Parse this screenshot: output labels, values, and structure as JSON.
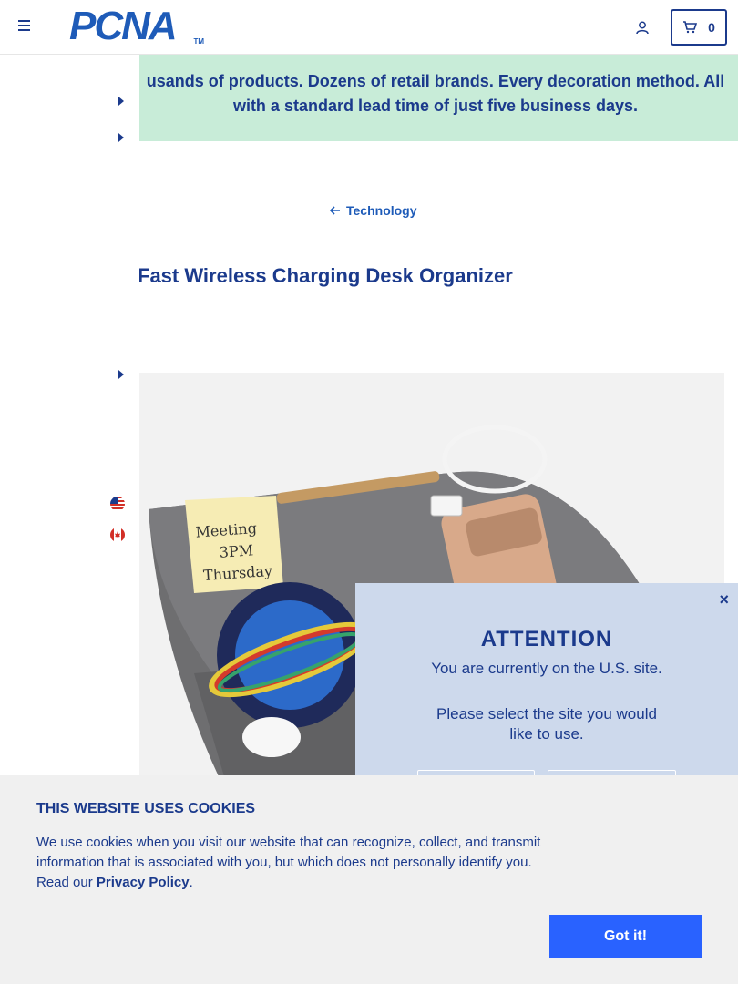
{
  "header": {
    "logo_text": "PCNA",
    "logo_tm": "TM",
    "cart_count": "0"
  },
  "banner": {
    "text": "usands of products. Dozens of retail brands. Every decoration method. All with a standard lead time of just five business days."
  },
  "breadcrumb": {
    "back_label": "Technology"
  },
  "product": {
    "title": "Fast Wireless Charging Desk Organizer",
    "image_note_text": "Meeting 3PM Thursday"
  },
  "locale_modal": {
    "title": "ATTENTION",
    "line1": "You are currently on the U.S. site.",
    "line2": "Please select the site you would like to use.",
    "close_label": "×"
  },
  "cookie_banner": {
    "title": "THIS WEBSITE USES COOKIES",
    "body_prefix": "We use cookies when you visit our website that can recognize, collect, and transmit information that is associated with you, but which does not personally identify you. Read our ",
    "policy_link": "Privacy Policy",
    "body_suffix": ".",
    "accept_label": "Got it!"
  },
  "colors": {
    "brand_navy": "#1b3a8c",
    "brand_blue": "#1e5bb8",
    "banner_green": "#c8ecd8",
    "modal_bg": "#cdd9ec",
    "cta_blue": "#2962ff"
  },
  "icons": {
    "menu": "hamburger-icon",
    "account": "user-icon",
    "cart": "cart-icon",
    "back": "arrow-left-icon",
    "expand": "caret-right-icon",
    "flag_us": "us-flag-icon",
    "flag_ca": "canada-flag-icon"
  }
}
